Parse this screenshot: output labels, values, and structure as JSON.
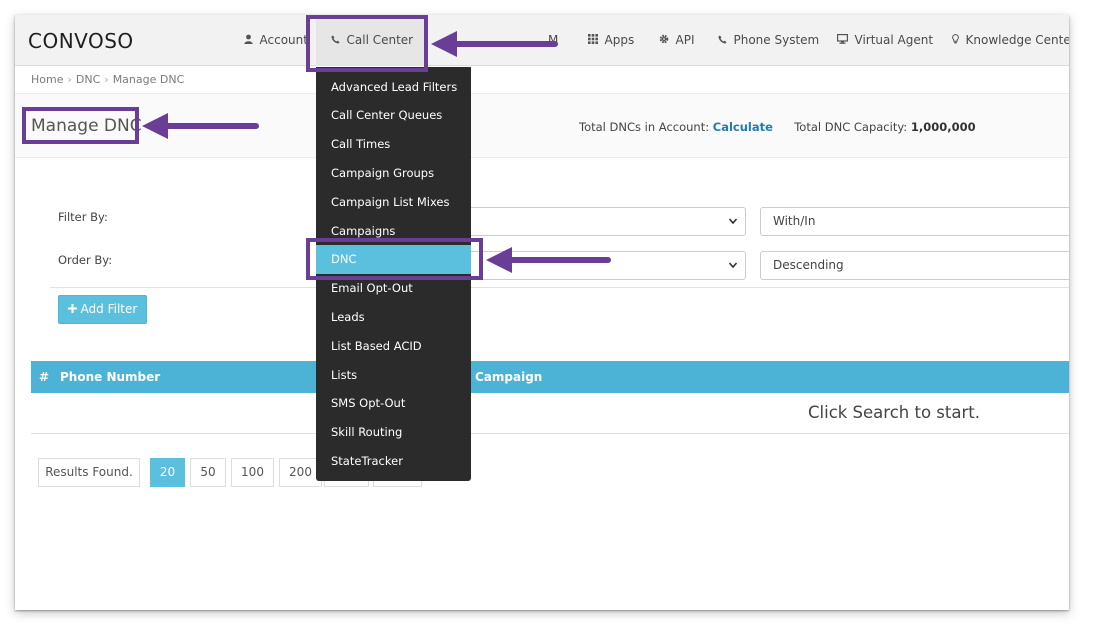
{
  "brand": {
    "logo_text": "CONVOSO"
  },
  "nav": {
    "account": "Account",
    "call_center": "Call Center",
    "crm_partial": "M",
    "apps": "Apps",
    "api": "API",
    "phone_system": "Phone System",
    "virtual_agent": "Virtual Agent",
    "knowledge_center": "Knowledge Center"
  },
  "breadcrumb": {
    "home": "Home",
    "dnc": "DNC",
    "current": "Manage DNC"
  },
  "page": {
    "title": "Manage DNC"
  },
  "stats": {
    "total_label": "Total DNCs in Account:",
    "total_link": "Calculate",
    "capacity_label": "Total DNC Capacity:",
    "capacity_value": "1,000,000"
  },
  "filters": {
    "filter_by_label": "Filter By:",
    "order_by_label": "Order By:",
    "filter_condition_value": "With/In",
    "order_direction_value": "Descending",
    "add_filter_label": "Add Filter"
  },
  "table": {
    "columns": [
      "#",
      "Phone Number",
      "Campaign"
    ],
    "empty_message": "Click Search to start."
  },
  "pagination": {
    "results_label": "Results Found.",
    "page_sizes": [
      "20",
      "50",
      "100",
      "200"
    ],
    "active_size": "20"
  },
  "dropdown": {
    "items": [
      "Advanced Lead Filters",
      "Call Center Queues",
      "Call Times",
      "Campaign Groups",
      "Campaign List Mixes",
      "Campaigns",
      "DNC",
      "Email Opt-Out",
      "Leads",
      "List Based ACID",
      "Lists",
      "SMS Opt-Out",
      "Skill Routing",
      "StateTracker"
    ],
    "active_item": "DNC"
  },
  "colors": {
    "accent": "#5bc0de",
    "table_header": "#4db3d6",
    "link": "#1f7db3",
    "annotation": "#6a3d96",
    "dropdown_bg": "#2b2b2b"
  },
  "icons": {
    "account": "user-icon",
    "call_center": "phone-icon",
    "apps": "grid-icon",
    "api": "gear-icon",
    "phone_system": "phone-icon",
    "virtual_agent": "monitor-icon",
    "knowledge_center": "lightbulb-icon"
  }
}
